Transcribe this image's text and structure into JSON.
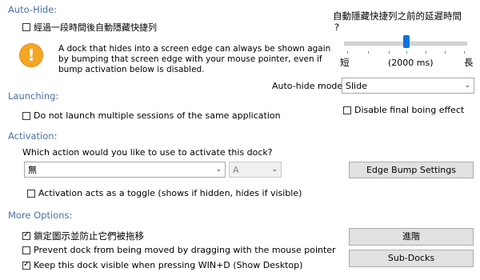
{
  "sections": {
    "autohide": "Auto-Hide:",
    "launching": "Launching:",
    "activation": "Activation:",
    "more_options": "More Options:"
  },
  "autohide": {
    "checkbox_label": "經過一段時間後自動隱藏快捷列",
    "checkbox_checked": false,
    "info_lines": [
      "A dock that hides into a screen edge can always be shown again",
      "by bumping that screen edge with your mouse pointer, even if",
      "bump activation below is disabled."
    ],
    "delay_title": "自動隱藏快捷列之前的延遲時間",
    "delay_title_q": "?",
    "slider_min_label": "短",
    "slider_max_label": "長",
    "slider_value_label": "(2000 ms)",
    "slider_fraction": 0.5,
    "mode_label": "Auto-hide mode:",
    "mode_value": "Slide",
    "boing_label": "Disable final boing effect",
    "boing_checked": false
  },
  "launching": {
    "checkbox_label": "Do not launch multiple sessions of the same application",
    "checked": false
  },
  "activation": {
    "question": "Which action would you like to use to activate this dock?",
    "action_value": "無",
    "key_value": "A",
    "edge_bump_button": "Edge Bump Settings",
    "toggle_label": "Activation acts as a toggle (shows if hidden, hides if visible)",
    "toggle_checked": false
  },
  "more_options": {
    "lock_label": "鎖定圖示並防止它們被拖移",
    "lock_checked": true,
    "prevent_move_label": "Prevent dock from being moved by dragging with the mouse pointer",
    "prevent_move_checked": false,
    "keep_visible_label": "Keep this dock visible when pressing WIN+D (Show Desktop)",
    "keep_visible_checked": true,
    "advanced_button": "進階",
    "subdocks_button": "Sub-Docks"
  },
  "colors": {
    "section": "#4a6fa5",
    "slider_thumb": "#0a74da",
    "warning": "#f5a623"
  },
  "icons": {
    "warning": "exclamation-warning-icon",
    "dropdown": "chevron-down-icon"
  }
}
